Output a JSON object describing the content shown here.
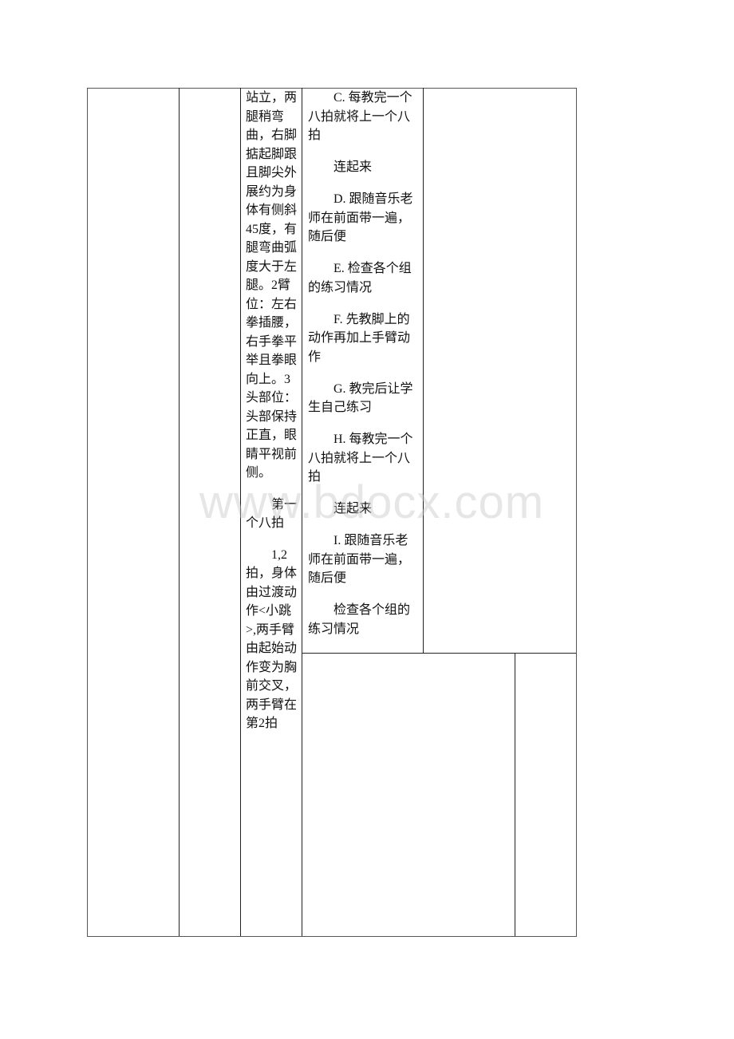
{
  "table": {
    "col3_paragraphs": [
      "站立，两腿稍弯曲，右脚掂起脚跟且脚尖外展约为身体有侧斜45度，有腿弯曲弧度大于左腿。2臂位：左右拳插腰，右手拳平举且拳眼向上。3头部位：头部保持正直，眼睛平视前侧。",
      "第一个八拍",
      "1,2拍，身体由过渡动作<小跳>,两手臂由起始动作变为胸前交叉，两手臂在第2拍"
    ],
    "col4_paragraphs": [
      "C. 每教完一个八拍就将上一个八拍",
      "连起来",
      "D. 跟随音乐老师在前面带一遍，随后便",
      "E. 检查各个组的练习情况",
      "F. 先教脚上的动作再加上手臂动作",
      "G. 教完后让学生自己练习",
      "H. 每教完一个八拍就将上一个八拍",
      "连起来",
      "I. 跟随音乐老师在前面带一遍，随后便",
      "检查各个组的练习情况"
    ]
  },
  "watermark": "www.bdocx.com"
}
